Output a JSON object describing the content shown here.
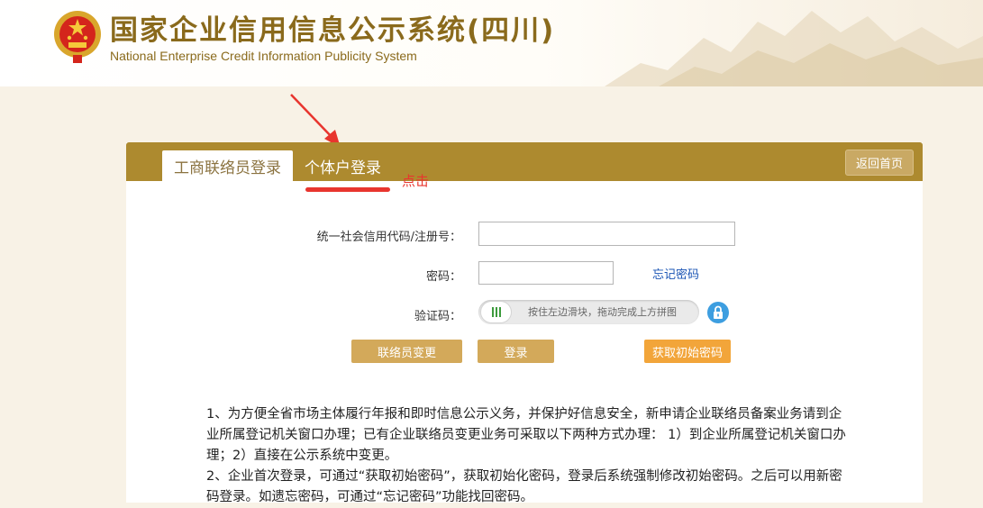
{
  "header": {
    "title": "国家企业信用信息公示系统(四川)",
    "subtitle": "National Enterprise Credit Information Publicity System",
    "emblem_icon": "national-emblem-icon",
    "brand_color": "#8a6a1c"
  },
  "tabs": {
    "liaison_login": "工商联络员登录",
    "individual_login": "个体户登录"
  },
  "back_home_label": "返回首页",
  "annotation": {
    "note": "点击",
    "color": "#e8352e"
  },
  "form": {
    "credit_code_label": "统一社会信用代码/注册号：",
    "credit_code_value": "",
    "password_label": "密码：",
    "password_value": "",
    "forgot_password_link": "忘记密码",
    "captcha_label": "验证码：",
    "slider_hint": "按住左边滑块，拖动完成上方拼图"
  },
  "buttons": {
    "liaison_change": "联络员变更",
    "login": "登录",
    "get_initial_password": "获取初始密码"
  },
  "colors": {
    "bar": "#ad8a2f",
    "button_gold": "#d3a95a",
    "button_orange": "#f2a53a",
    "link": "#1a54b4"
  },
  "notice": [
    "1、为方便全省市场主体履行年报和即时信息公示义务，并保护好信息安全，新申请企业联络员备案业务请到企业所属登记机关窗口办理；已有企业联络员变更业务可采取以下两种方式办理： 1）到企业所属登记机关窗口办理；2）直接在公示系统中变更。",
    "2、企业首次登录，可通过“获取初始密码”，获取初始化密码，登录后系统强制修改初始密码。之后可以用新密码登录。如遗忘密码，可通过“忘记密码”功能找回密码。"
  ]
}
